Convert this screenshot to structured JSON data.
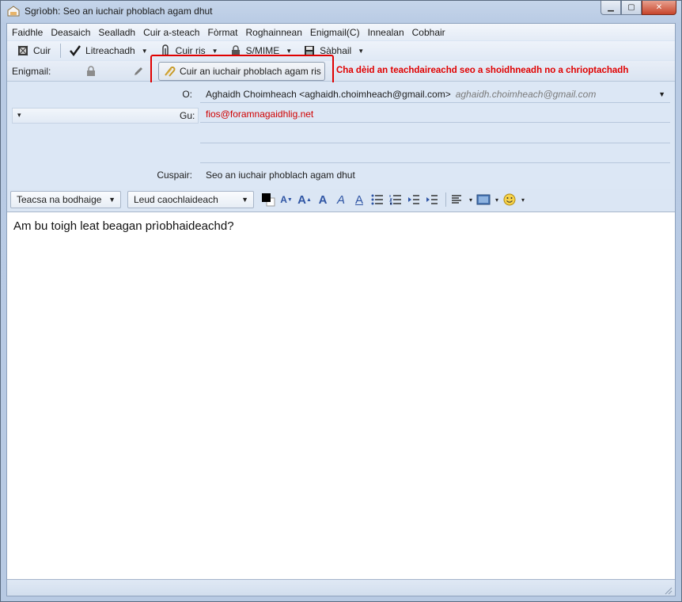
{
  "window": {
    "title": "Sgrìobh: Seo an iuchair phoblach agam dhut"
  },
  "menu": [
    "Faidhle",
    "Deasaich",
    "Sealladh",
    "Cuir a-steach",
    "Fòrmat",
    "Roghainnean",
    "Enigmail(C)",
    "Innealan",
    "Cobhair"
  ],
  "toolbar": {
    "send": "Cuir",
    "spell": "Litreachadh",
    "attach": "Cuir ris",
    "smime": "S/MIME",
    "save": "Sàbhail"
  },
  "enigmail": {
    "label": "Enigmail:",
    "attach_key_button": "Cuir an iuchair phoblach agam ris",
    "annotation": "Cha dèid an teachdaireachd seo a shoidhneadh no a chrioptachadh"
  },
  "headers": {
    "from_label": "O:",
    "from_value": "Aghaidh Choimheach <aghaidh.choimheach@gmail.com>",
    "from_hint": "aghaidh.choimheach@gmail.com",
    "to_label": "Gu:",
    "to_value": "fios@foramnagaidhlig.net",
    "subject_label": "Cuspair:",
    "subject_value": "Seo an iuchair phoblach agam dhut"
  },
  "format": {
    "paragraph_style": "Teacsa na bodhaige",
    "font": "Leud caochlaideach"
  },
  "body": {
    "text": "Am bu toigh leat beagan prìobhaideachd?"
  }
}
